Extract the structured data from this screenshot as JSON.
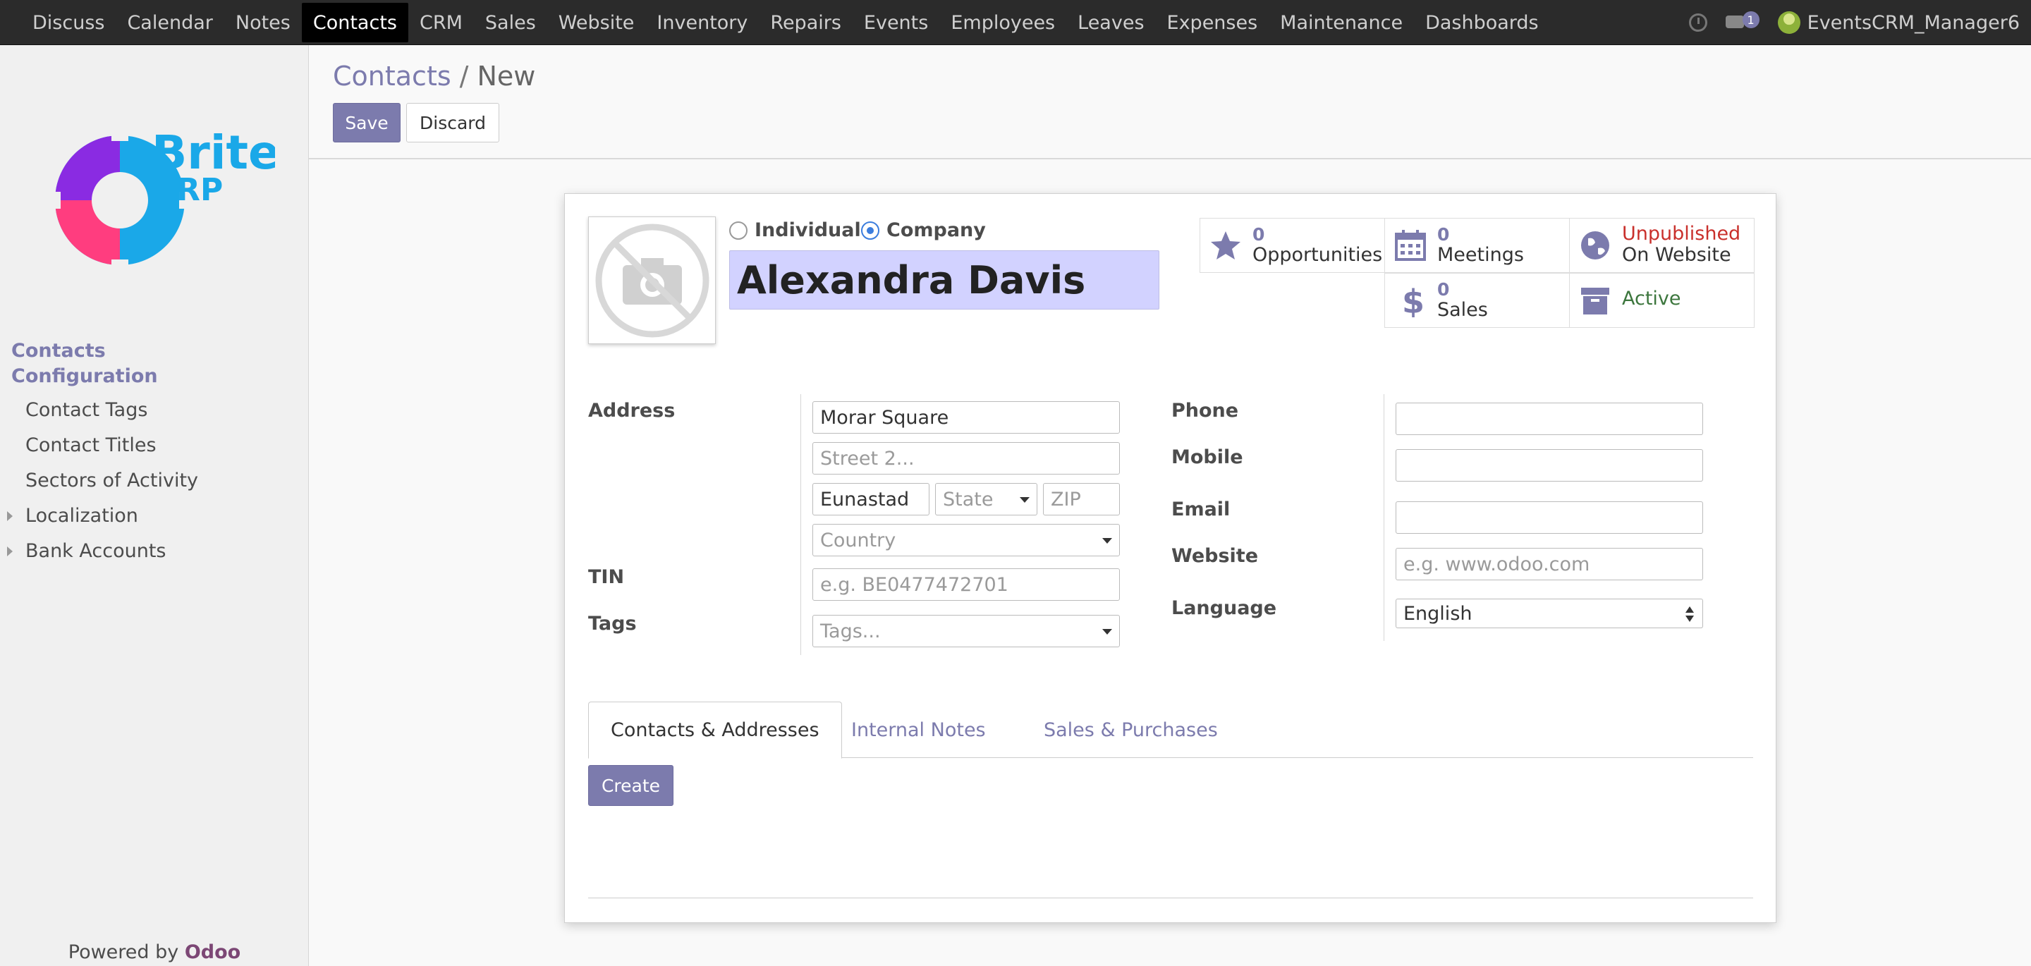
{
  "topnav": {
    "items": [
      "Discuss",
      "Calendar",
      "Notes",
      "Contacts",
      "CRM",
      "Sales",
      "Website",
      "Inventory",
      "Repairs",
      "Events",
      "Employees",
      "Leaves",
      "Expenses",
      "Maintenance",
      "Dashboards"
    ],
    "active": "Contacts",
    "chat_count": "1",
    "user_name": "EventsCRM_Manager6"
  },
  "sidebar": {
    "logo_text_top": "Brite",
    "logo_text_bottom": "ERP",
    "section_contacts": "Contacts",
    "section_configuration": "Configuration",
    "items": [
      "Contact Tags",
      "Contact Titles",
      "Sectors of Activity",
      "Localization",
      "Bank Accounts"
    ],
    "powered_prefix": "Powered by ",
    "powered_brand": "Odoo"
  },
  "breadcrumb": {
    "parent": "Contacts",
    "separator": "/",
    "current": "New"
  },
  "buttons": {
    "save": "Save",
    "discard": "Discard",
    "create": "Create"
  },
  "form": {
    "type_individual": "Individual",
    "type_company": "Company",
    "selected_type": "Company",
    "name": "Alexandra Davis",
    "stats": {
      "opportunities": {
        "count": "0",
        "label": "Opportunities"
      },
      "meetings": {
        "count": "0",
        "label": "Meetings"
      },
      "website": {
        "line1": "Unpublished",
        "line2": "On Website"
      },
      "sales": {
        "count": "0",
        "label": "Sales"
      },
      "active": "Active"
    },
    "labels": {
      "address": "Address",
      "tin": "TIN",
      "tags": "Tags",
      "phone": "Phone",
      "mobile": "Mobile",
      "email": "Email",
      "website": "Website",
      "language": "Language"
    },
    "values": {
      "street": "Morar Square",
      "street2_placeholder": "Street 2...",
      "city": "Eunastad",
      "state_placeholder": "State",
      "zip_placeholder": "ZIP",
      "country_placeholder": "Country",
      "tin_placeholder": "e.g. BE0477472701",
      "tags_placeholder": "Tags...",
      "phone": "",
      "mobile": "",
      "email": "",
      "website_placeholder": "e.g. www.odoo.com",
      "language": "English"
    },
    "tabs": [
      "Contacts & Addresses",
      "Internal Notes",
      "Sales & Purchases"
    ],
    "active_tab": "Contacts & Addresses"
  },
  "colors": {
    "primary": "#7c7bad",
    "unpublished": "#c9302c",
    "active": "#3c763d",
    "name_bg": "#d2d2ff"
  }
}
